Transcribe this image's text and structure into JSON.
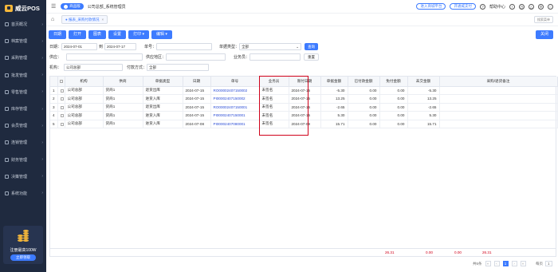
{
  "app": {
    "logo_text": "威云POS"
  },
  "sidebar": {
    "items": [
      {
        "label": "首页概况",
        "icon": "home-icon"
      },
      {
        "label": "档案管理",
        "icon": "folder-icon"
      },
      {
        "label": "采购管理",
        "icon": "cart-icon"
      },
      {
        "label": "批发管理",
        "icon": "wholesale-icon"
      },
      {
        "label": "零售管理",
        "icon": "shop-icon"
      },
      {
        "label": "库存管理",
        "icon": "box-icon"
      },
      {
        "label": "会员管理",
        "icon": "member-icon"
      },
      {
        "label": "连锁管理",
        "icon": "chain-icon"
      },
      {
        "label": "财务管理",
        "icon": "finance-icon"
      },
      {
        "label": "决策管理",
        "icon": "chart-icon"
      },
      {
        "label": "系统功能",
        "icon": "settings-icon"
      }
    ],
    "promo": {
      "title": "注册最高100W",
      "button": "立即领取"
    }
  },
  "topbar": {
    "store_pill": "商品版",
    "company": "公司总部_系统管理员",
    "links": [
      "进入商城平台",
      "开通威支付"
    ],
    "help": "帮助中心"
  },
  "tabs": {
    "items": [
      "报表_采购付款情况"
    ],
    "search": "搜索菜单"
  },
  "toolbar": {
    "buttons": [
      "日期",
      "打开",
      "图表",
      "设置",
      "打印",
      "编辑"
    ],
    "close": "关闭"
  },
  "filters": {
    "date_label": "日期：",
    "date_from": "2024-07-01",
    "to_label": "到",
    "date_to": "2024-07-17",
    "order_no_label": "单号：",
    "order_type_label": "单据类型：",
    "order_type_value": "全部",
    "query": "查询",
    "supplier_label": "供应：",
    "region_label": "供应地区：",
    "salesman_label": "业务员：",
    "reset": "重置",
    "org_label": "机构：",
    "org_value": "公司总部",
    "pay_method_label": "付款方式：",
    "pay_method_value": "全部"
  },
  "table": {
    "headers": [
      "",
      "",
      "机构",
      "供商",
      "单据类型",
      "日期",
      "单号",
      "业务员",
      "限付日期",
      "单据金额",
      "已付款金额",
      "免付金额",
      "未交金额",
      "采购/退货备注"
    ],
    "rows": [
      [
        "1",
        "公司总部",
        "货商1",
        "退货出库",
        "2024-07-15",
        "RO00002407150002",
        "未签名",
        "2024-07-15",
        "-5.30",
        "0.00",
        "0.00",
        "-5.30",
        ""
      ],
      [
        "2",
        "公司总部",
        "货商1",
        "进货入库",
        "2024-07-15",
        "PI00002407150002",
        "未签名",
        "2024-07-15",
        "13.25",
        "0.00",
        "0.00",
        "13.25",
        ""
      ],
      [
        "3",
        "公司总部",
        "货商1",
        "退货出库",
        "2024-07-15",
        "RO00002407150001",
        "未签名",
        "2024-07-15",
        "-2.65",
        "0.00",
        "0.00",
        "-2.65",
        ""
      ],
      [
        "4",
        "公司总部",
        "货商1",
        "进货入库",
        "2024-07-15",
        "PI00002407150001",
        "未签名",
        "2024-07-15",
        "5.30",
        "0.00",
        "0.00",
        "5.30",
        ""
      ],
      [
        "5",
        "公司总部",
        "货商1",
        "进货入库",
        "2024-07-08",
        "PI00002407080001",
        "未签名",
        "2024-07-08",
        "15.71",
        "0.00",
        "0.00",
        "15.71",
        ""
      ]
    ],
    "totals": {
      "amount": "26.31",
      "paid": "0.00",
      "free": "0.00",
      "unpaid": "26.31"
    }
  },
  "pager": {
    "total": "共5条",
    "page": "1",
    "per_label": "每页",
    "per_value": "1"
  }
}
